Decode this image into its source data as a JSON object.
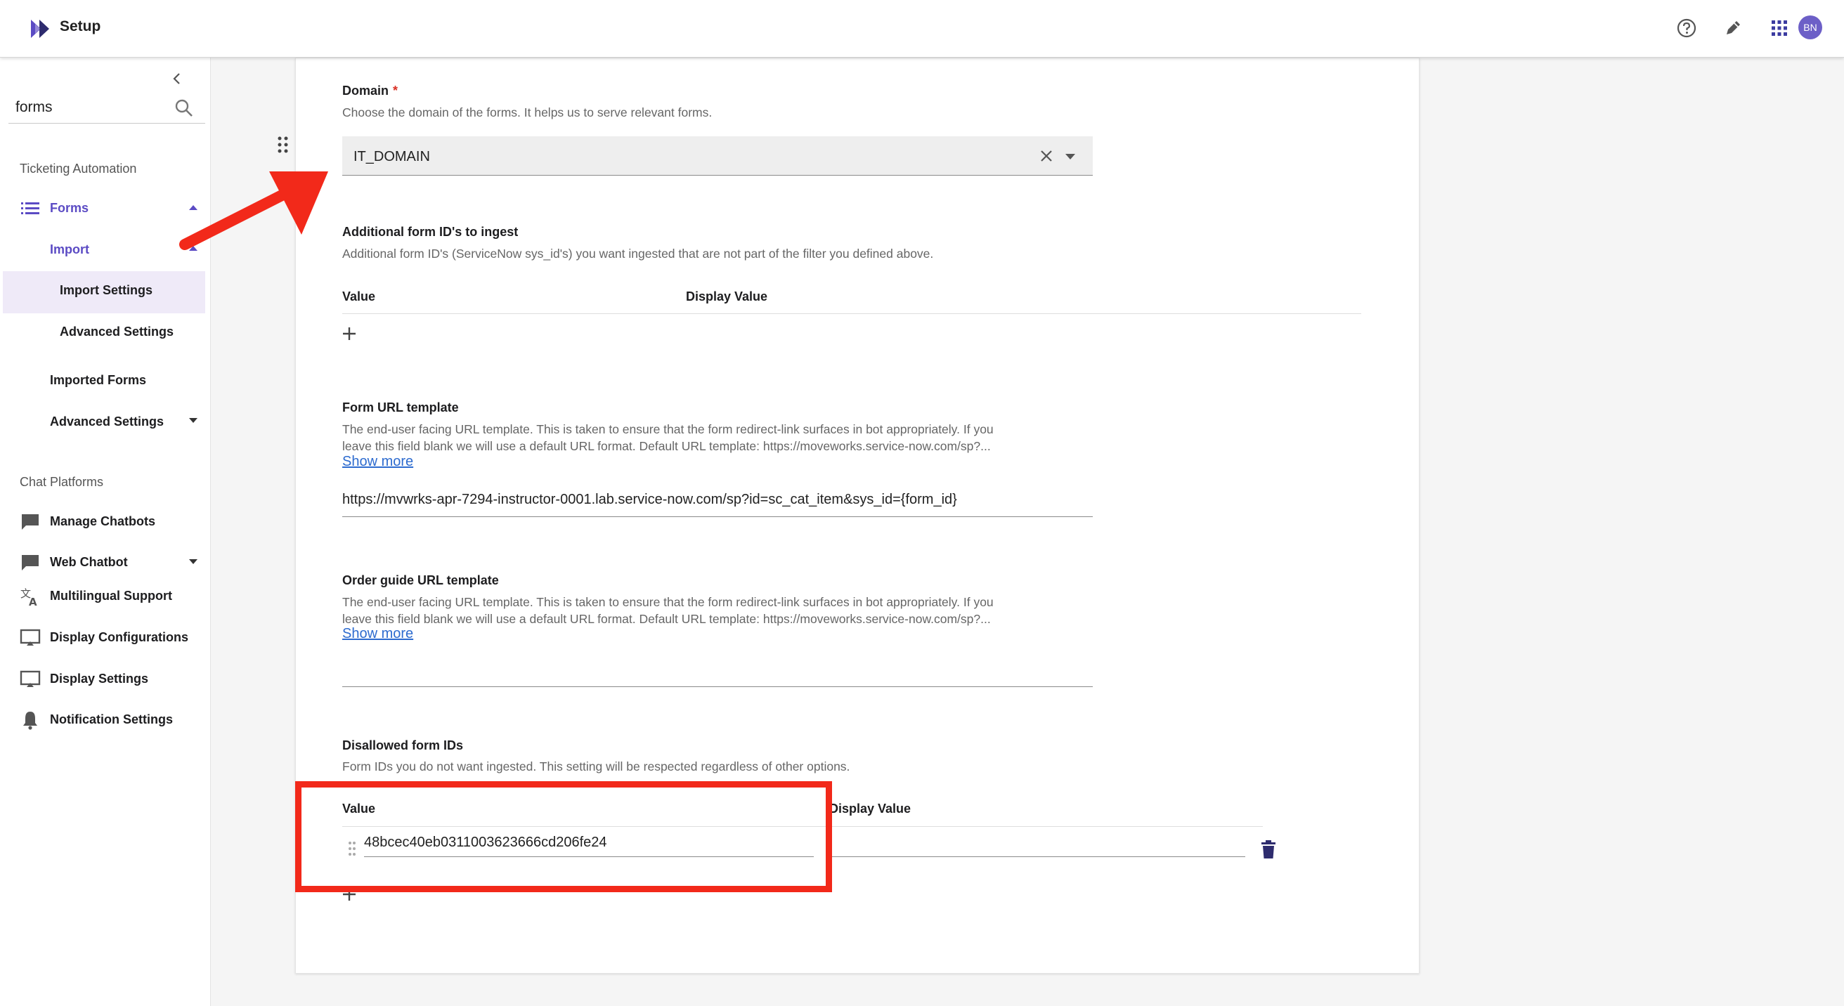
{
  "header": {
    "title": "Setup",
    "avatar_initials": "BN",
    "brand_color": "#5b4bc4"
  },
  "sidebar": {
    "search": {
      "value": "forms"
    },
    "sections": {
      "ticketing": "Ticketing Automation",
      "chat": "Chat Platforms"
    },
    "items": {
      "forms": "Forms",
      "import": "Import",
      "import_settings": "Import Settings",
      "advanced_settings_sub": "Advanced Settings",
      "imported_forms": "Imported Forms",
      "advanced_settings": "Advanced Settings",
      "manage_chatbots": "Manage Chatbots",
      "web_chatbot": "Web Chatbot",
      "multilingual_support": "Multilingual Support",
      "display_configurations": "Display Configurations",
      "display_settings": "Display Settings",
      "notification_settings": "Notification Settings"
    }
  },
  "main": {
    "domain": {
      "label": "Domain",
      "required_mark": "*",
      "description": "Choose the domain of the forms. It helps us to serve relevant forms.",
      "value": "IT_DOMAIN"
    },
    "additional_ids": {
      "label": "Additional form ID's to ingest",
      "description": "Additional form ID's (ServiceNow sys_id's) you want ingested that are not part of the filter you defined above.",
      "col_value": "Value",
      "col_display": "Display Value"
    },
    "form_url": {
      "label": "Form URL template",
      "description_line1": "The end-user facing URL template. This is taken to ensure that the form redirect-link surfaces in bot appropriately. If you",
      "description_line2": "leave this field blank we will use a default URL format. Default URL template: https://moveworks.service-now.com/sp?...",
      "show_more": "Show more",
      "value": "https://mvwrks-apr-7294-instructor-0001.lab.service-now.com/sp?id=sc_cat_item&sys_id={form_id}"
    },
    "order_guide_url": {
      "label": "Order guide URL template",
      "description_line1": "The end-user facing URL template. This is taken to ensure that the form redirect-link surfaces in bot appropriately. If you",
      "description_line2": "leave this field blank we will use a default URL format. Default URL template: https://moveworks.service-now.com/sp?...",
      "show_more": "Show more",
      "value": ""
    },
    "disallowed_ids": {
      "label": "Disallowed form IDs",
      "description": "Form IDs you do not want ingested. This setting will be respected regardless of other options.",
      "col_value": "Value",
      "col_display": "Display Value",
      "rows": [
        {
          "value": "48bcec40eb0311003623666cd206fe24",
          "display": ""
        }
      ]
    }
  },
  "annotations": {
    "highlight_color": "#f2291a"
  }
}
